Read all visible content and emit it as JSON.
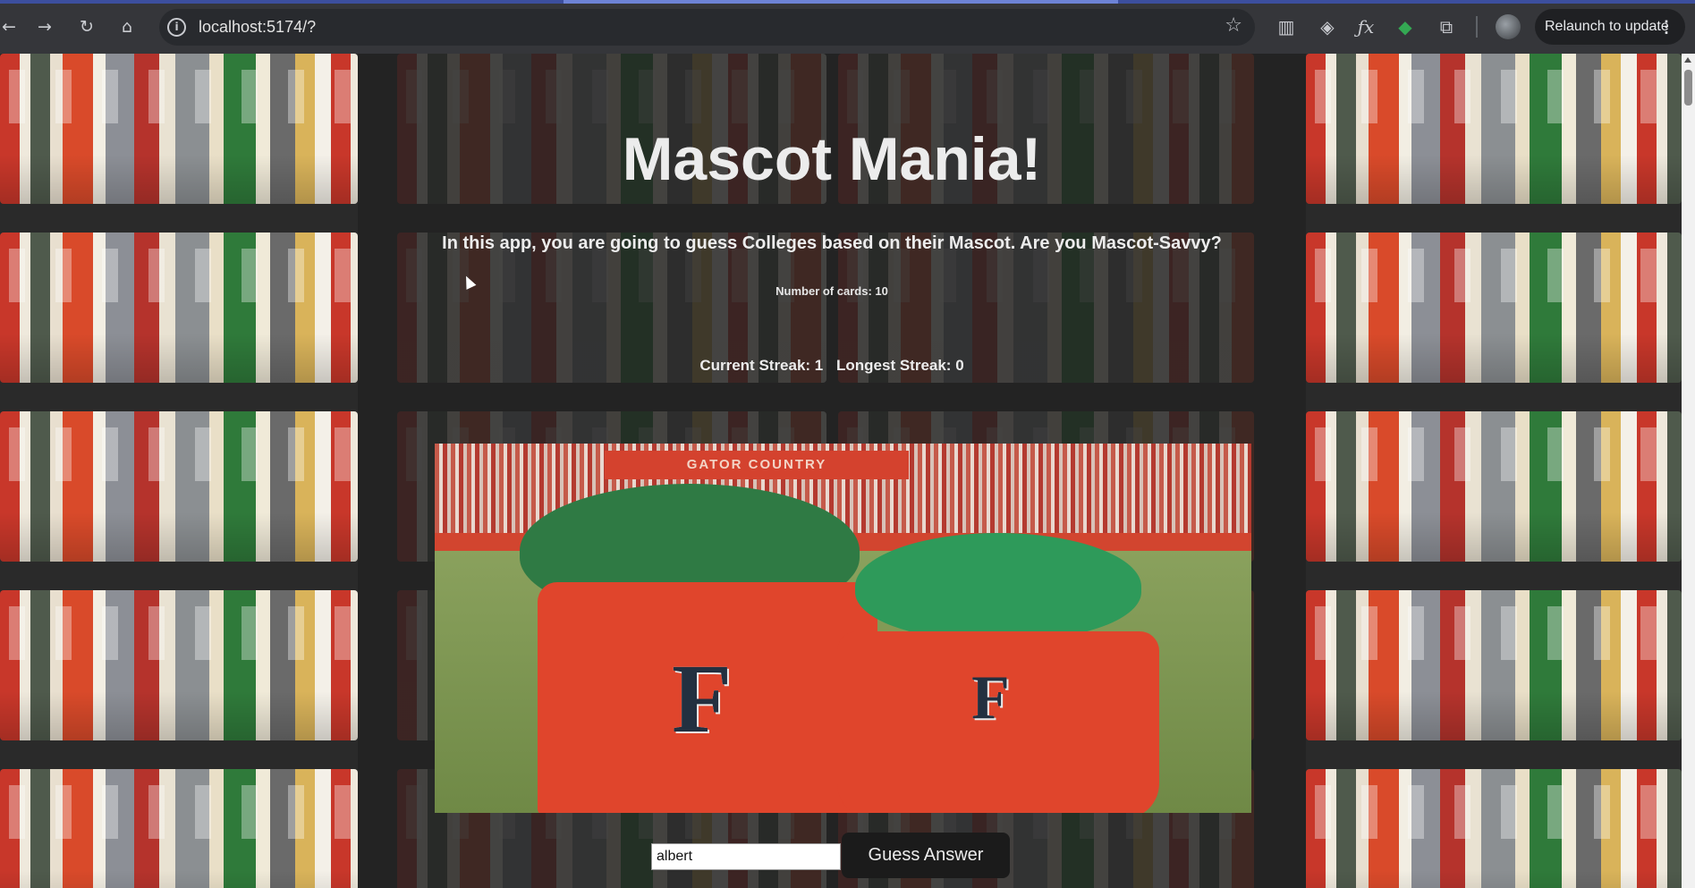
{
  "browser": {
    "url": "localhost:5174/?",
    "relaunch_label": "Relaunch to update",
    "nav": {
      "back": "←",
      "forward": "→",
      "reload": "↻",
      "home": "⌂"
    },
    "icons": [
      "site-info-icon",
      "bookmark-star-icon",
      "reading-list-icon",
      "extension-tab-icon",
      "fx-extension-icon",
      "color-extension-icon",
      "extensions-puzzle-icon",
      "profile-avatar-icon",
      "more-menu-icon"
    ]
  },
  "app": {
    "title": "Mascot Mania!",
    "intro": "In this app, you are going to guess Colleges based on their Mascot. Are you Mascot-Savvy?",
    "cards_label": "Number of cards: 10",
    "current_streak": "Current Streak: 1",
    "longest_streak": "Longest Streak: 0",
    "photo_banner": "GATOR COUNTRY",
    "jersey_letter": "F",
    "guess_value": "albert",
    "guess_button": "Guess Answer"
  },
  "colors": {
    "chrome": "#35363a",
    "page_bg": "#2a2a2a",
    "button_bg": "#1b1b1b",
    "text": "#ececec"
  }
}
